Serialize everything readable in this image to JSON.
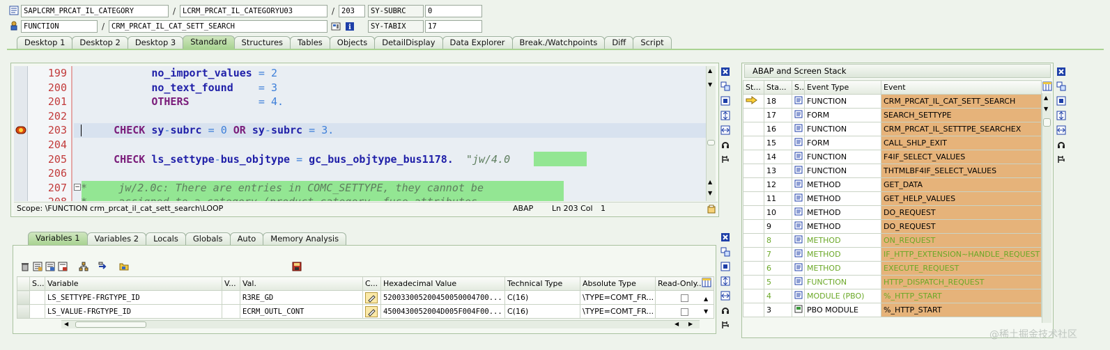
{
  "header": {
    "program": "SAPLCRM_PRCAT_IL_CATEGORY",
    "include": "LCRM_PRCAT_IL_CATEGORYU03",
    "line": "203",
    "subrc_label": "SY-SUBRC",
    "subrc_value": "0",
    "event_type": "FUNCTION",
    "event_name": "CRM_PRCAT_IL_CAT_SETT_SEARCH",
    "tabix_label": "SY-TABIX",
    "tabix_value": "17",
    "slash": "/"
  },
  "main_tabs": [
    {
      "label": "Desktop 1",
      "active": false
    },
    {
      "label": "Desktop 2",
      "active": false
    },
    {
      "label": "Desktop 3",
      "active": false
    },
    {
      "label": "Standard",
      "active": true
    },
    {
      "label": "Structures",
      "active": false
    },
    {
      "label": "Tables",
      "active": false
    },
    {
      "label": "Objects",
      "active": false
    },
    {
      "label": "DetailDisplay",
      "active": false
    },
    {
      "label": "Data Explorer",
      "active": false
    },
    {
      "label": "Break./Watchpoints",
      "active": false
    },
    {
      "label": "Diff",
      "active": false
    },
    {
      "label": "Script",
      "active": false
    }
  ],
  "code": {
    "lines": [
      {
        "num": "199"
      },
      {
        "num": "200"
      },
      {
        "num": "201"
      },
      {
        "num": "202"
      },
      {
        "num": "203"
      },
      {
        "num": "204"
      },
      {
        "num": "205"
      },
      {
        "num": "206"
      },
      {
        "num": "207"
      },
      {
        "num": "208"
      }
    ],
    "t199a": "no_import_values",
    "t199b": " = ",
    "t199c": "2",
    "t200a": "no_text_found",
    "t200b": "    = ",
    "t200c": "3",
    "t201a": "OTHERS",
    "t201b": "           = ",
    "t201c": "4",
    "t201d": ".",
    "t203a": "CHECK",
    "t203b": " sy",
    "t203c": "-",
    "t203d": "subrc ",
    "t203e": "=",
    "t203f": " ",
    "t203g": "0",
    "t203h": " ",
    "t203i": "OR",
    "t203j": " sy",
    "t203k": "-",
    "t203l": "subrc ",
    "t203m": "=",
    "t203n": " ",
    "t203o": "3",
    "t203p": ".",
    "t205a": "CHECK",
    "t205b": " ls_settype",
    "t205c": "-",
    "t205d": "bus_objtype ",
    "t205e": "=",
    "t205f": " gc_bus_objtype_bus1178.  ",
    "t205g": "\"jw/4.0",
    "t207": "*     jw/2.0c: There are entries in COMC_SETTYPE, they cannot be",
    "t208": "*     assigned to a category (product category, fuse attributes",
    "scope": "Scope: \\FUNCTION crm_prcat_il_cat_sett_search\\LOOP",
    "lang": "ABAP",
    "pos": "Ln 203 Col",
    "col": "1"
  },
  "var_tabs": [
    {
      "label": "Variables 1",
      "active": true
    },
    {
      "label": "Variables 2",
      "active": false
    },
    {
      "label": "Locals",
      "active": false
    },
    {
      "label": "Globals",
      "active": false
    },
    {
      "label": "Auto",
      "active": false
    },
    {
      "label": "Memory Analysis",
      "active": false
    }
  ],
  "var_table": {
    "headers": [
      "S...",
      "Variable",
      "V...",
      "Val.",
      "C...",
      "Hexadecimal Value",
      "Technical Type",
      "Absolute Type",
      "Read-Only..."
    ],
    "rows": [
      {
        "variable": "LS_SETTYPE-FRGTYPE_ID",
        "value": "R3RE_GD",
        "hex": "520033005200450050004700...",
        "tech": "C(16)",
        "abs": "\\TYPE=COMT_FR..."
      },
      {
        "variable": "LS_VALUE-FRGTYPE_ID",
        "value": "ECRM_OUTL_CONT",
        "hex": "4500430052004D005F004F00...",
        "tech": "C(16)",
        "abs": "\\TYPE=COMT_FR..."
      }
    ]
  },
  "stack": {
    "title": "ABAP and Screen Stack",
    "headers": [
      "St...",
      "Sta...",
      "S...",
      "Event Type",
      "Event"
    ],
    "rows": [
      {
        "num": "18",
        "type": "FUNCTION",
        "event": "CRM_PRCAT_IL_CAT_SETT_SEARCH",
        "green": false,
        "current": true
      },
      {
        "num": "17",
        "type": "FORM",
        "event": "SEARCH_SETTYPE",
        "green": false,
        "current": false
      },
      {
        "num": "16",
        "type": "FUNCTION",
        "event": "CRM_PRCAT_IL_SETTTPE_SEARCHEX",
        "green": false,
        "current": false
      },
      {
        "num": "15",
        "type": "FORM",
        "event": "CALL_SHLP_EXIT",
        "green": false,
        "current": false
      },
      {
        "num": "14",
        "type": "FUNCTION",
        "event": "F4IF_SELECT_VALUES",
        "green": false,
        "current": false
      },
      {
        "num": "13",
        "type": "FUNCTION",
        "event": "THTMLBF4IF_SELECT_VALUES",
        "green": false,
        "current": false
      },
      {
        "num": "12",
        "type": "METHOD",
        "event": "GET_DATA",
        "green": false,
        "current": false
      },
      {
        "num": "11",
        "type": "METHOD",
        "event": "GET_HELP_VALUES",
        "green": false,
        "current": false
      },
      {
        "num": "10",
        "type": "METHOD",
        "event": "DO_REQUEST",
        "green": false,
        "current": false
      },
      {
        "num": "9",
        "type": "METHOD",
        "event": "DO_REQUEST",
        "green": false,
        "current": false
      },
      {
        "num": "8",
        "type": "METHOD",
        "event": "ON_REQUEST",
        "green": true,
        "current": false
      },
      {
        "num": "7",
        "type": "METHOD",
        "event": "IF_HTTP_EXTENSION~HANDLE_REQUEST",
        "green": true,
        "current": false
      },
      {
        "num": "6",
        "type": "METHOD",
        "event": "EXECUTE_REQUEST",
        "green": true,
        "current": false
      },
      {
        "num": "5",
        "type": "FUNCTION",
        "event": "HTTP_DISPATCH_REQUEST",
        "green": true,
        "current": false
      },
      {
        "num": "4",
        "type": "MODULE (PBO)",
        "event": "%_HTTP_START",
        "green": true,
        "current": false
      },
      {
        "num": "3",
        "type": "PBO MODULE",
        "event": "%_HTTP_START",
        "green": false,
        "current": false
      }
    ]
  },
  "watermark": "@稀土掘金技术社区",
  "colors": {
    "accent_green": "#a9d392",
    "stack_orange": "#e6b37a",
    "line_number_red": "#c23b3b",
    "keyword_blue": "#1f1fa8"
  }
}
